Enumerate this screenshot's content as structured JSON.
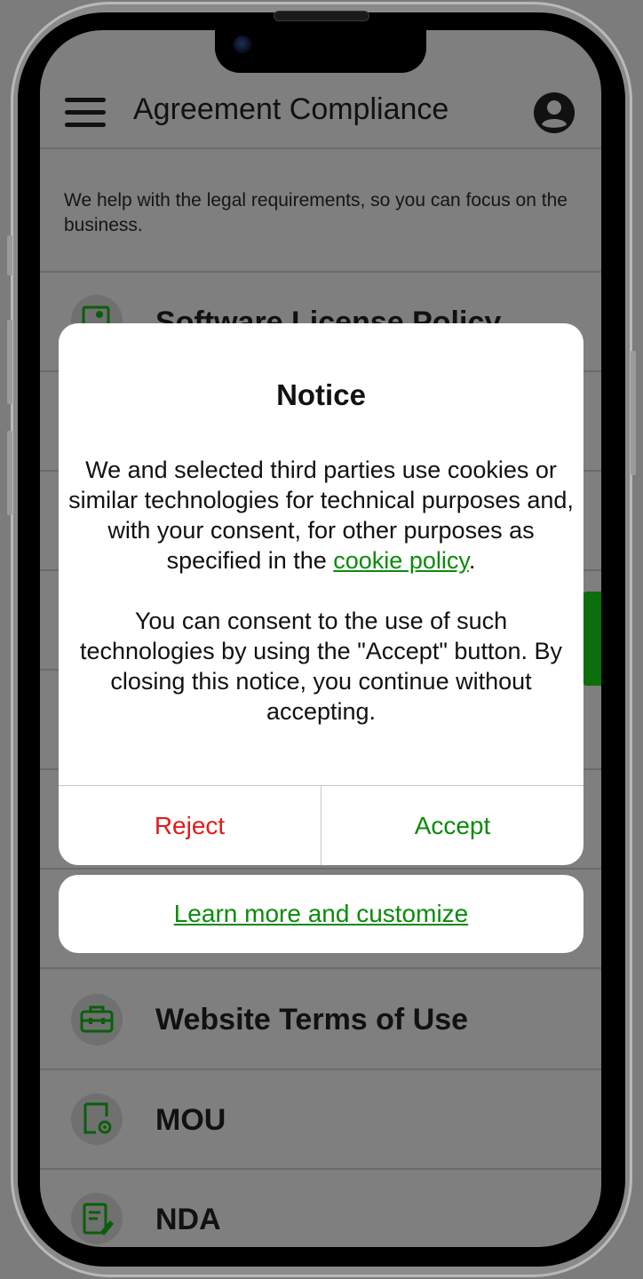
{
  "app": {
    "title": "Agreement Compliance",
    "tagline": "We help with the legal requirements, so you can focus on the business.",
    "accent_color": "#0c8a0c"
  },
  "list": {
    "items": [
      {
        "label": "Software License Policy",
        "icon": "document-lock-icon"
      },
      {
        "label": "Website Terms of Use",
        "icon": "toolbox-icon"
      },
      {
        "label": "MOU",
        "icon": "document-gear-icon"
      },
      {
        "label": "NDA",
        "icon": "document-pen-icon"
      }
    ]
  },
  "dialog": {
    "title": "Notice",
    "body_intro": "We and selected third parties use cookies or similar technologies for technical purposes and, with your consent, for other purposes as specified in the ",
    "cookie_link": "cookie policy",
    "body_intro_end": ".",
    "body_second": "You can consent to the use of such technologies by using the \"Accept\" button. By closing this notice, you continue without accepting.",
    "reject_label": "Reject",
    "accept_label": "Accept",
    "reject_color": "#e01b1b"
  },
  "learn_more_label": "Learn more and customize"
}
